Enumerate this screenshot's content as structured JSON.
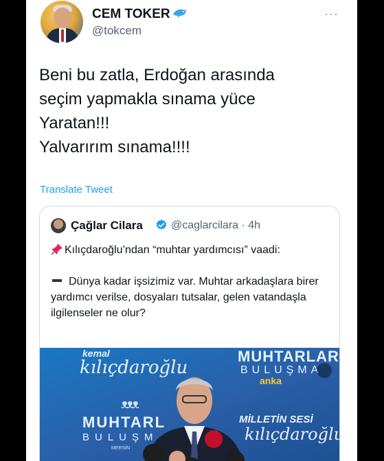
{
  "tweet": {
    "author_name": "CEM TOKER",
    "author_handle": "@tokcem",
    "more_icon": "···",
    "text": "Beni bu zatla, Erdoğan arasında\nseçim yapmakla sınama yüce\nYaratan!!!\nYalvarırım sınama!!!!",
    "translate_label": "Translate Tweet"
  },
  "quoted": {
    "author_name": "Çağlar Cilara",
    "author_handle": "@caglarcilara · 4h",
    "line1": "Kılıçdaroğlu’ndan “muhtar yardımcısı” vaadi:",
    "line2": "Dünya kadar işsizimiz var. Muhtar arkadaşlara birer yardımcı verilse, dosyaları tutsalar, gelen vatandaşla ilgilenseler ne olur?",
    "media": {
      "kemal": "kemal",
      "script_name": "kılıçdaroğlu",
      "muhtarlar": "MUHTARLAR",
      "bulusma": "BULUŞMA",
      "anka": "anka",
      "logo": "ᴥᴥᴥ",
      "muhtarl": "MUHTARL",
      "bulusm": "BULUŞM",
      "mersin": "MERSİN",
      "milletin_sesi": "MİLLETİN SESİ",
      "script_name2": "kılıçdaroğlu"
    }
  },
  "colors": {
    "link": "#1d9bf0",
    "verified": "#1d9bf0",
    "text": "#0f1419",
    "muted": "#536471"
  }
}
